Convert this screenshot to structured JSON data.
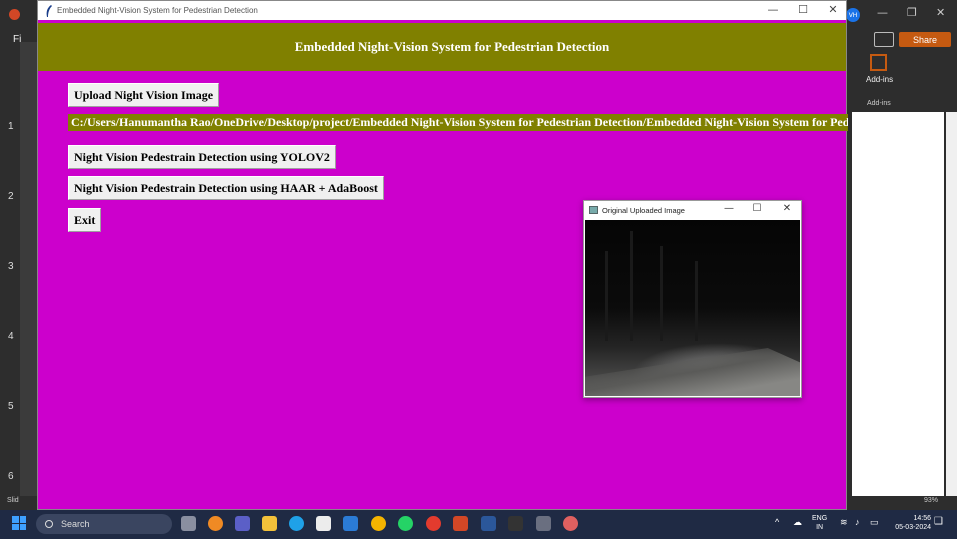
{
  "background_app": {
    "name": "PowerPoint",
    "file_menu_fragment": "Fi",
    "share_label": "Share",
    "addins_label": "Add-ins",
    "addins_group": "Add-ins",
    "avatar_initials": "VH",
    "ruler_numbers": [
      "1",
      "2",
      "3",
      "4",
      "5",
      "6"
    ],
    "status_left": "Slid",
    "zoom": "93%"
  },
  "main_window": {
    "title": "Embedded Night-Vision System for Pedestrian Detection",
    "header": "Embedded Night-Vision System for Pedestrian Detection",
    "upload_button": "Upload Night Vision Image",
    "path_label": "C:/Users/Hanumantha Rao/OneDrive/Desktop/project/Embedded Night-Vision System for Pedestrian Detection/Embedded Night-Vision System for Pedes",
    "yolo_button": "Night Vision Pedestrain Detection using YOLOV2",
    "haar_button": "Night Vision Pedestrain Detection using HAAR + AdaBoost",
    "exit_button": "Exit",
    "colors": {
      "background": "#cc00cc",
      "header": "#808000",
      "header_text": "#ffffff"
    }
  },
  "image_window": {
    "title": "Original Uploaded Image"
  },
  "taskbar": {
    "search_placeholder": "Search",
    "language": "ENG",
    "region": "IN",
    "time": "14:56",
    "date": "05-03-2024"
  }
}
